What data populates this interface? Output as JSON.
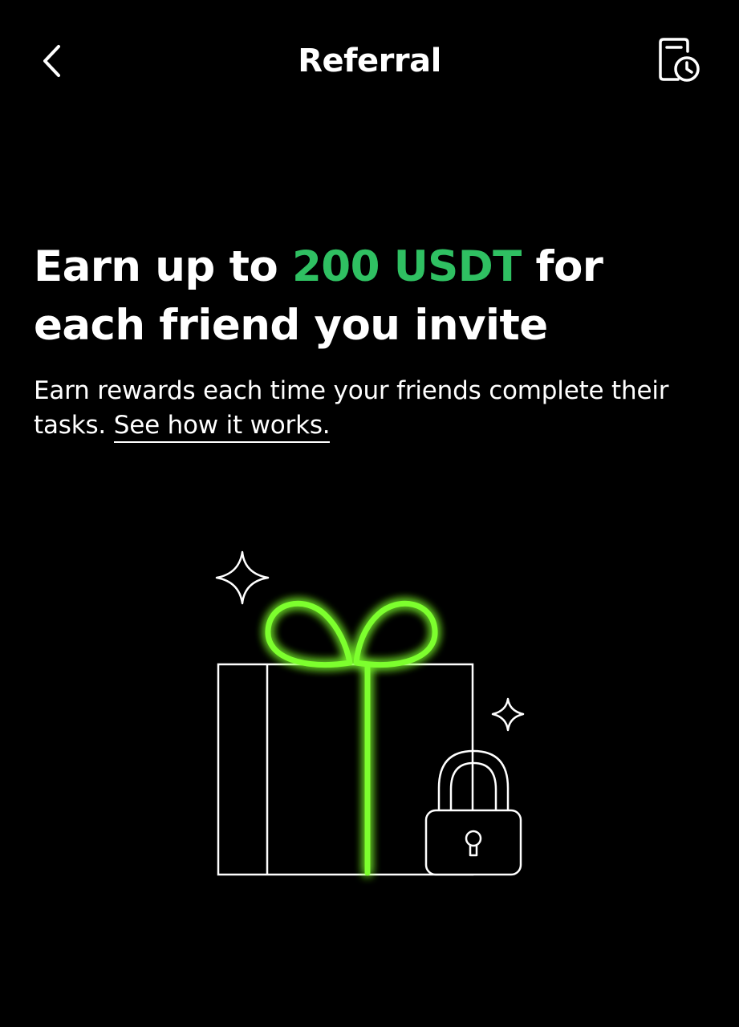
{
  "header": {
    "title": "Referral",
    "back_icon": "chevron-left-icon",
    "history_icon": "document-clock-icon"
  },
  "hero": {
    "headline_part1": "Earn up to ",
    "headline_accent": "200 USDT",
    "headline_part2": " for each friend you invite",
    "subtext": "Earn rewards each time your friends complete their tasks. ",
    "link_label": "See how it works."
  },
  "illustration": {
    "icons": [
      "gift-box-icon",
      "ribbon-bow-icon",
      "padlock-icon",
      "sparkle-icon"
    ]
  },
  "colors": {
    "background": "#000000",
    "text": "#ffffff",
    "accent": "#2fc062",
    "neon": "#7dff2e"
  }
}
